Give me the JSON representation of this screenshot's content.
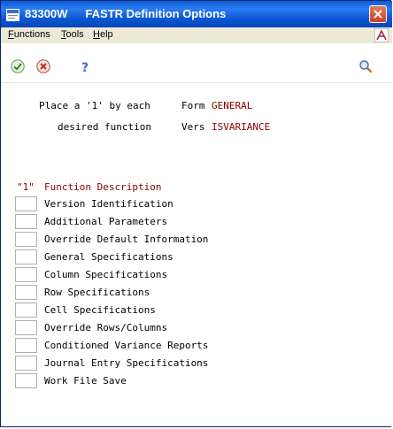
{
  "window": {
    "program_id": "83300W",
    "title": "FASTR Definition Options"
  },
  "menu": {
    "functions_u": "F",
    "functions_rest": "unctions",
    "tools_u": "T",
    "tools_rest": "ools",
    "help_u": "H",
    "help_rest": "elp"
  },
  "toolbar": {
    "icons": [
      "ok-check-icon",
      "cancel-x-icon",
      "help-question-icon",
      "search-magnifier-icon"
    ]
  },
  "header": {
    "instruction_line1": "Place a '1' by each",
    "instruction_line2": "desired function",
    "form_label": "Form",
    "form_value": "GENERAL",
    "vers_label": "Vers",
    "vers_value": "ISVARIANCE"
  },
  "list": {
    "col_select_header": "\"1\"",
    "col_desc_header": "Function Description",
    "items": [
      {
        "label": "Version Identification",
        "value": ""
      },
      {
        "label": "Additional Parameters",
        "value": ""
      },
      {
        "label": "Override Default Information",
        "value": ""
      },
      {
        "label": "General Specifications",
        "value": ""
      },
      {
        "label": "Column Specifications",
        "value": ""
      },
      {
        "label": "Row Specifications",
        "value": ""
      },
      {
        "label": "Cell Specifications",
        "value": ""
      },
      {
        "label": "Override Rows/Columns",
        "value": ""
      },
      {
        "label": "Conditioned Variance Reports",
        "value": ""
      },
      {
        "label": "Journal Entry Specifications",
        "value": ""
      },
      {
        "label": "Work File Save",
        "value": ""
      }
    ]
  },
  "colors": {
    "title_bar": "#0a55d0",
    "field_value": "#8b0000",
    "menu_bg": "#ece9d8"
  }
}
